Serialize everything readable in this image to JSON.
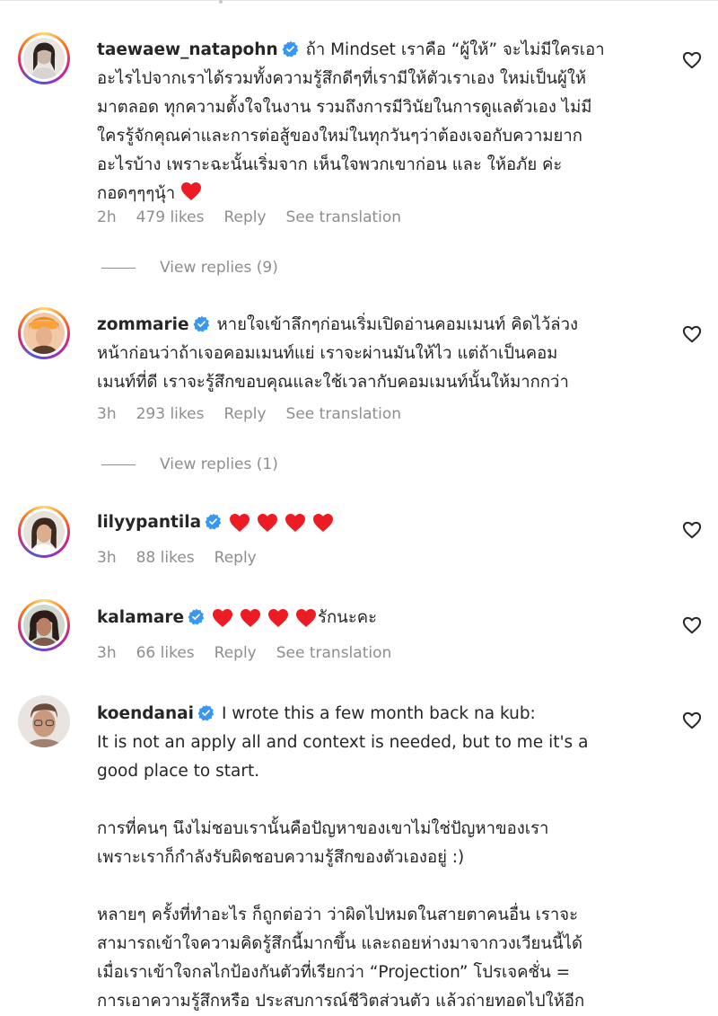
{
  "comments": [
    {
      "username": "taewaew_natapohn",
      "lines": [
        "ถ้า Mindset เราคือ “ผู้ให้” จะไม่มีใครเอา",
        "อะไรไปจากเราได้รวมทั้งความรู้สึกดีๆที่เรามีให้ตัวเราเอง ใหม่เป็นผู้ให้",
        "มาตลอด ทุกความตั้งใจในงาน รวมถึงการมีวินัยในการดูแลตัวเอง ไม่มี",
        "ใครรู้จักคุณค่าและการต่อสู้ของใหม่ในทุกวันๆว่าต้องเจอกับความยาก",
        "อะไรบ้าง เพราะฉะนั้นเริ่มจาก เห็นใจพวกเขาก่อน และ ให้อภัย ค่ะ",
        "กอดๆๆๆนุ้า"
      ],
      "time": "2h",
      "likes": "479 likes",
      "reply": "Reply",
      "translation": "See translation",
      "view_replies": "View replies (9)"
    },
    {
      "username": "zommarie",
      "lines": [
        "หายใจเข้าลึกๆก่อนเริ่มเปิดอ่านคอมเมนท์ คิดไว้ล่วง",
        "หน้าก่อนว่าถ้าเจอคอมเมนท์แย่ เราจะผ่านมันให้ไว แต่ถ้าเป็นคอม",
        "เมนท์ที่ดี เราจะรู้สึกขอบคุณและใช้เวลากับคอมเมนท์นั้นให้มากกว่า"
      ],
      "time": "3h",
      "likes": "293 likes",
      "reply": "Reply",
      "translation": "See translation",
      "view_replies": "View replies (1)"
    },
    {
      "username": "lilyypantila",
      "time": "3h",
      "likes": "88 likes",
      "reply": "Reply"
    },
    {
      "username": "kalamare",
      "suffix": "รักนะคะ",
      "time": "3h",
      "likes": "66 likes",
      "reply": "Reply",
      "translation": "See translation"
    },
    {
      "username": "koendanai",
      "lines": [
        "I wrote this a few month back na kub:",
        "It is not an apply all and context is needed, but to me it's a",
        "good place to start.",
        "",
        "การที่คนๆ นึงไม่ชอบเรานั้นคือปัญหาของเขาไม่ใช่ปัญหาของเรา",
        "เพราะเราก็กำลังรับผิดชอบความรู้สึกของตัวเองอยู่ :)",
        "",
        "หลายๆ ครั้งที่ทำอะไร ก็ถูกต่อว่า ว่าผิดไปหมดในสายตาคนอื่น เราจะ",
        "สามารถเข้าใจความคิดรู้สึกนี้มากขึ้น และถอยห่างมาจากวงเวียนนี้ได้",
        "เมื่อเราเข้าใจกลไกป้องกันตัวที่เรียกว่า “Projection” โปรเจคชั่น =",
        "การเอาความรู้สึกหรือ ประสบการณ์ชีวิตส่วนตัว แล้วถ่ายทอดไปให้อีก"
      ]
    }
  ],
  "colors": {
    "heart": "#ed1c24",
    "verified": "#3897f0",
    "meta": "#8e8e8e"
  }
}
